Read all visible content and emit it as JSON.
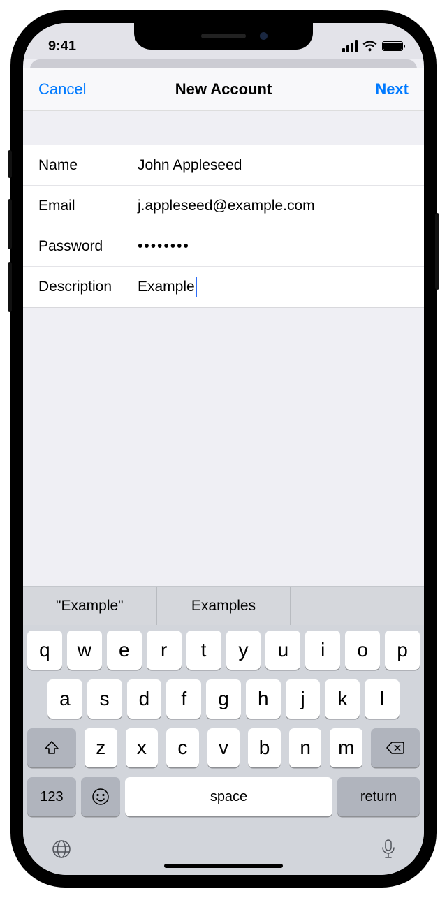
{
  "status": {
    "time": "9:41"
  },
  "nav": {
    "cancel": "Cancel",
    "title": "New Account",
    "next": "Next"
  },
  "fields": {
    "name": {
      "label": "Name",
      "value": "John Appleseed"
    },
    "email": {
      "label": "Email",
      "value": "j.appleseed@example.com"
    },
    "password": {
      "label": "Password",
      "value": "••••••••"
    },
    "description": {
      "label": "Description",
      "value": "Example"
    }
  },
  "suggestions": [
    "\"Example\"",
    "Examples",
    ""
  ],
  "keyboard": {
    "row1": [
      "q",
      "w",
      "e",
      "r",
      "t",
      "y",
      "u",
      "i",
      "o",
      "p"
    ],
    "row2": [
      "a",
      "s",
      "d",
      "f",
      "g",
      "h",
      "j",
      "k",
      "l"
    ],
    "row3": [
      "z",
      "x",
      "c",
      "v",
      "b",
      "n",
      "m"
    ],
    "numbers": "123",
    "space": "space",
    "return": "return"
  }
}
